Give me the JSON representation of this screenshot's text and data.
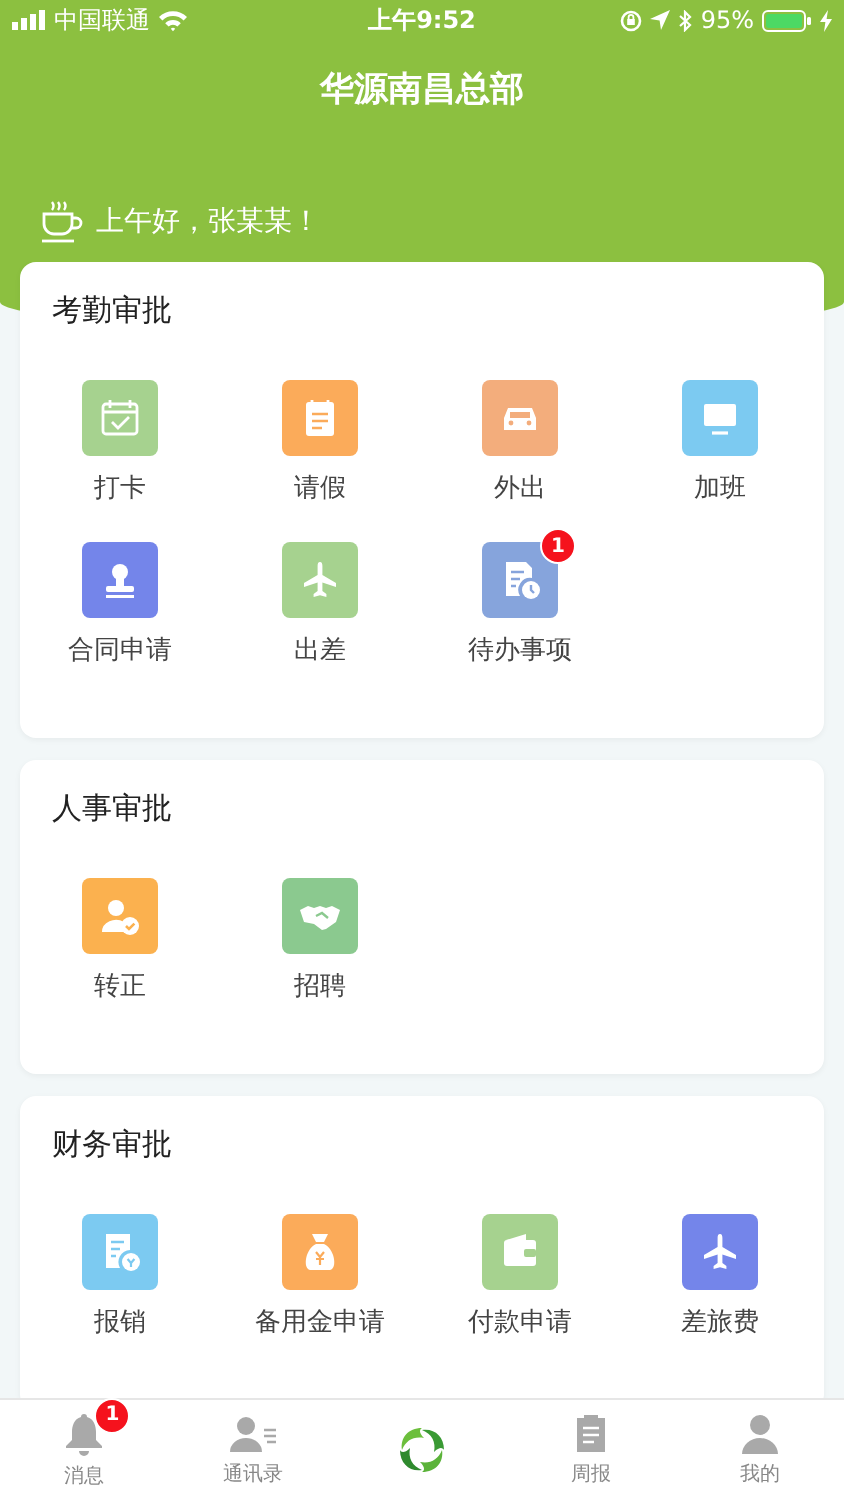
{
  "status_bar": {
    "carrier": "中国联通",
    "time": "上午9:52",
    "battery": "95%"
  },
  "header": {
    "title": "华源南昌总部",
    "greeting": "上午好，张某某！"
  },
  "sections": [
    {
      "title": "考勤审批",
      "items": [
        {
          "label": "打卡",
          "kind": "calendar",
          "color": "#a6d28f"
        },
        {
          "label": "请假",
          "kind": "note",
          "color": "#fbab5a"
        },
        {
          "label": "外出",
          "kind": "car",
          "color": "#f3ad7c"
        },
        {
          "label": "加班",
          "kind": "monitor",
          "color": "#7ccaf1"
        },
        {
          "label": "合同申请",
          "kind": "stamp",
          "color": "#7485ea"
        },
        {
          "label": "出差",
          "kind": "plane",
          "color": "#a6d28f"
        },
        {
          "label": "待办事项",
          "kind": "document-clock",
          "color": "#86a4dc",
          "badge": "1"
        }
      ]
    },
    {
      "title": "人事审批",
      "items": [
        {
          "label": "转正",
          "kind": "person-check",
          "color": "#fbb14f"
        },
        {
          "label": "招聘",
          "kind": "handshake",
          "color": "#8bc98f"
        }
      ]
    },
    {
      "title": "财务审批",
      "items": [
        {
          "label": "报销",
          "kind": "receipt",
          "color": "#7ccaf1"
        },
        {
          "label": "备用金申请",
          "kind": "money-bag",
          "color": "#fbab5a"
        },
        {
          "label": "付款申请",
          "kind": "wallet",
          "color": "#a6d28f"
        },
        {
          "label": "差旅费",
          "kind": "plane",
          "color": "#7485ea"
        }
      ]
    }
  ],
  "tab_bar": [
    {
      "label": "消息",
      "kind": "bell",
      "badge": "1"
    },
    {
      "label": "通讯录",
      "kind": "contacts"
    },
    {
      "kind": "logo"
    },
    {
      "label": "周报",
      "kind": "clipboard"
    },
    {
      "label": "我的",
      "kind": "person"
    }
  ]
}
